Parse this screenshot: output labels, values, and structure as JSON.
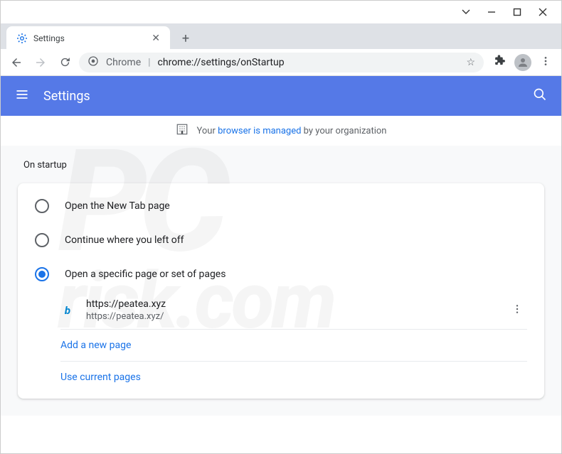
{
  "window": {
    "tab_title": "Settings"
  },
  "omnibox": {
    "prefix": "Chrome",
    "url": "chrome://settings/onStartup"
  },
  "header": {
    "title": "Settings"
  },
  "banner": {
    "pre": "Your ",
    "link": "browser is managed",
    "post": " by your organization"
  },
  "section": {
    "title": "On startup"
  },
  "startup": {
    "options": [
      {
        "label": "Open the New Tab page",
        "selected": false
      },
      {
        "label": "Continue where you left off",
        "selected": false
      },
      {
        "label": "Open a specific page or set of pages",
        "selected": true
      }
    ],
    "pages": [
      {
        "title": "https://peatea.xyz",
        "url": "https://peatea.xyz/",
        "favicon": "b"
      }
    ],
    "add_label": "Add a new page",
    "current_label": "Use current pages"
  },
  "watermark": {
    "line1": "PC",
    "line2": "risk.com"
  }
}
